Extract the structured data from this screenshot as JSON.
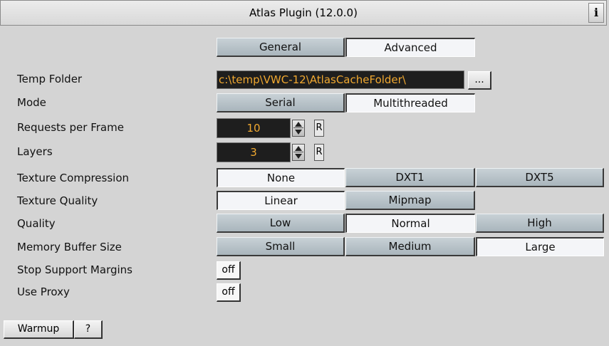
{
  "window": {
    "title": "Atlas Plugin (12.0.0)",
    "info_label": "i"
  },
  "tabs": [
    {
      "label": "General",
      "selected": false
    },
    {
      "label": "Advanced",
      "selected": true
    }
  ],
  "fields": {
    "temp_folder": {
      "label": "Temp Folder",
      "value": "c:\\temp\\VWC-12\\AtlasCacheFolder\\",
      "browse_label": "..."
    },
    "mode": {
      "label": "Mode",
      "options": [
        "Serial",
        "Multithreaded"
      ],
      "selected": "Multithreaded"
    },
    "requests_per_frame": {
      "label": "Requests per Frame",
      "value": "10",
      "reset_label": "R"
    },
    "layers": {
      "label": "Layers",
      "value": "3",
      "reset_label": "R"
    },
    "texture_compression": {
      "label": "Texture Compression",
      "options": [
        "None",
        "DXT1",
        "DXT5"
      ],
      "selected": "None"
    },
    "texture_quality": {
      "label": "Texture Quality",
      "options": [
        "Linear",
        "Mipmap"
      ],
      "selected": "Linear"
    },
    "quality": {
      "label": "Quality",
      "options": [
        "Low",
        "Normal",
        "High"
      ],
      "selected": "Normal"
    },
    "memory_buffer_size": {
      "label": "Memory Buffer Size",
      "options": [
        "Small",
        "Medium",
        "Large"
      ],
      "selected": "Large"
    },
    "stop_support_margins": {
      "label": "Stop Support Margins",
      "value": "off"
    },
    "use_proxy": {
      "label": "Use Proxy",
      "value": "off"
    }
  },
  "footer": {
    "warmup_label": "Warmup",
    "help_label": "?"
  },
  "colors": {
    "field_bg": "#1e1e1e",
    "field_text": "#f0a830",
    "panel_bg": "#d4d4d4"
  }
}
